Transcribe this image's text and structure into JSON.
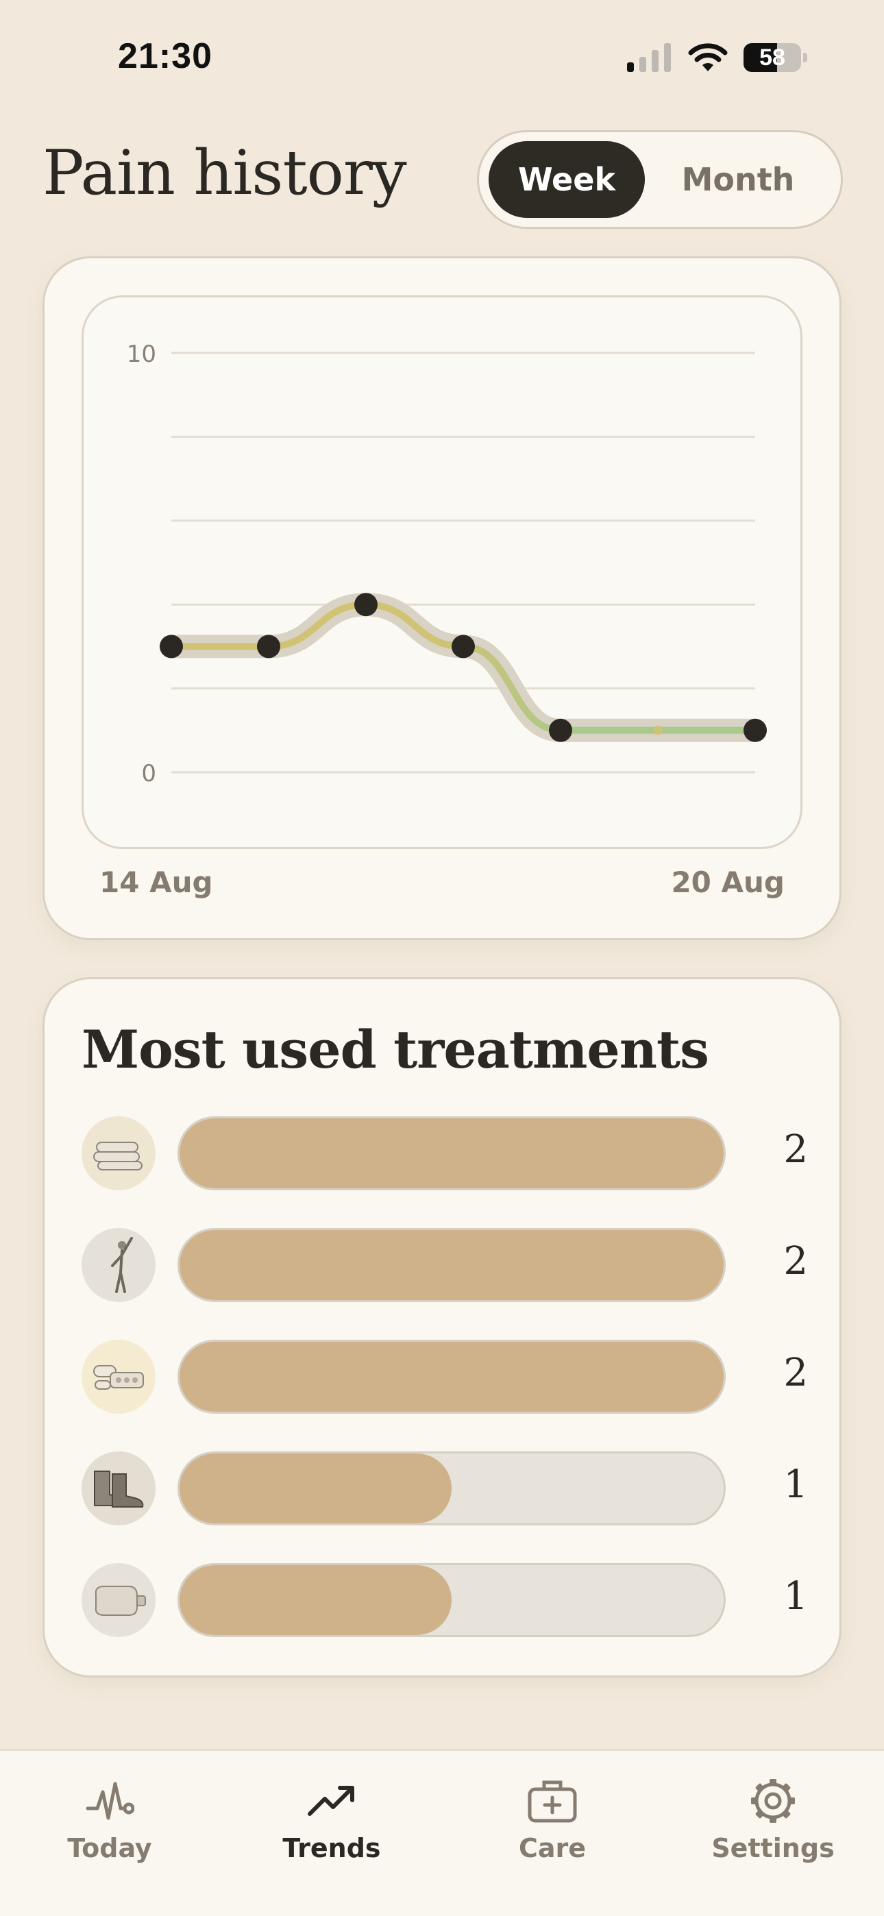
{
  "status_bar": {
    "time": "21:30",
    "battery": "58",
    "battery_level": 0.58
  },
  "header": {
    "title": "Pain history"
  },
  "range_toggle": {
    "options": [
      "Week",
      "Month"
    ],
    "selected": "Week"
  },
  "chart_data": {
    "type": "line",
    "title": "",
    "x": [
      "14 Aug",
      "15 Aug",
      "16 Aug",
      "17 Aug",
      "18 Aug",
      "19 Aug",
      "20 Aug"
    ],
    "series": [
      {
        "values": [
          3,
          3,
          4,
          3,
          1,
          1,
          1
        ]
      }
    ],
    "ylim": [
      0,
      10
    ],
    "y_tick_labels": [
      "10",
      "0"
    ],
    "x_tick_labels": [
      "14 Aug",
      "20 Aug"
    ],
    "grid": true,
    "colors": {
      "high": "#d2c274",
      "low": "#a9c98b",
      "band": "#d9d3c6",
      "point": "#2b2823"
    }
  },
  "treatments": {
    "title": "Most used treatments",
    "max": 2,
    "items": [
      {
        "icon": "towel-icon",
        "count": "2",
        "value": 2
      },
      {
        "icon": "stretching-figure-icon",
        "count": "2",
        "value": 2
      },
      {
        "icon": "pills-icon",
        "count": "2",
        "value": 2
      },
      {
        "icon": "boots-icon",
        "count": "1",
        "value": 1
      },
      {
        "icon": "hot-water-bottle-icon",
        "count": "1",
        "value": 1
      }
    ]
  },
  "tab_bar": {
    "tabs": [
      {
        "label": "Today",
        "icon": "pulse-icon"
      },
      {
        "label": "Trends",
        "icon": "trend-up-icon"
      },
      {
        "label": "Care",
        "icon": "first-aid-kit-icon"
      },
      {
        "label": "Settings",
        "icon": "gear-icon"
      }
    ],
    "active": "Trends"
  }
}
